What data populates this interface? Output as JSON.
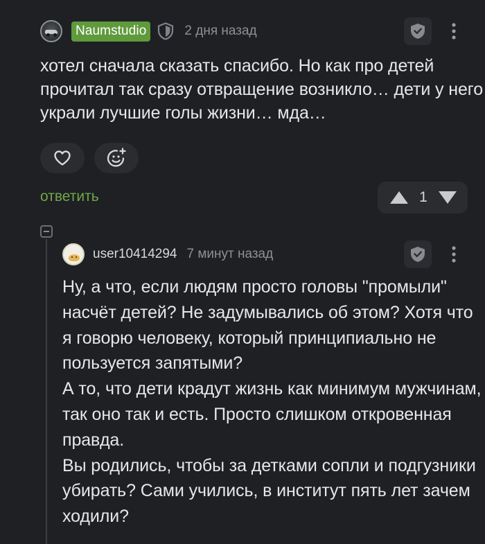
{
  "comment": {
    "author": "Naumstudio",
    "time": "2 дня назад",
    "text": "хотел сначала сказать спасибо. Но как про детей прочитал так сразу отвращение возникло… дети у него украли лучшие голы жизни… мда…",
    "reply_label": "ответить",
    "rating": "1",
    "icons": {
      "avatar": "car-avatar",
      "badge": "shield-icon",
      "moderate": "shield-check-icon",
      "more": "more-vertical-icon",
      "like": "heart-icon",
      "react": "emoji-add-icon",
      "upvote": "arrow-up-icon",
      "downvote": "arrow-down-icon"
    },
    "colors": {
      "author_badge": "#5f9a3c",
      "reply_link": "#6ea84a",
      "background": "#1f2023"
    }
  },
  "reply": {
    "author": "user10414294",
    "time": "7 минут назад",
    "paragraphs": [
      "Ну, а что, если людям просто головы \"промыли\" насчёт детей? Не задумывались об этом? Хотя что я говорю человеку, который принципиально не пользуется запятыми?",
      "А то, что дети крадут жизнь как минимум мужчинам, так оно так и есть. Просто слишком откровенная правда.",
      "Вы родились, чтобы за детками сопли и подгузники убирать? Сами учились, в институт пять лет зачем ходили?"
    ],
    "icons": {
      "avatar": "cartoon-avatar",
      "moderate": "shield-check-icon",
      "more": "more-vertical-icon",
      "collapse": "collapse-minus-icon"
    }
  }
}
